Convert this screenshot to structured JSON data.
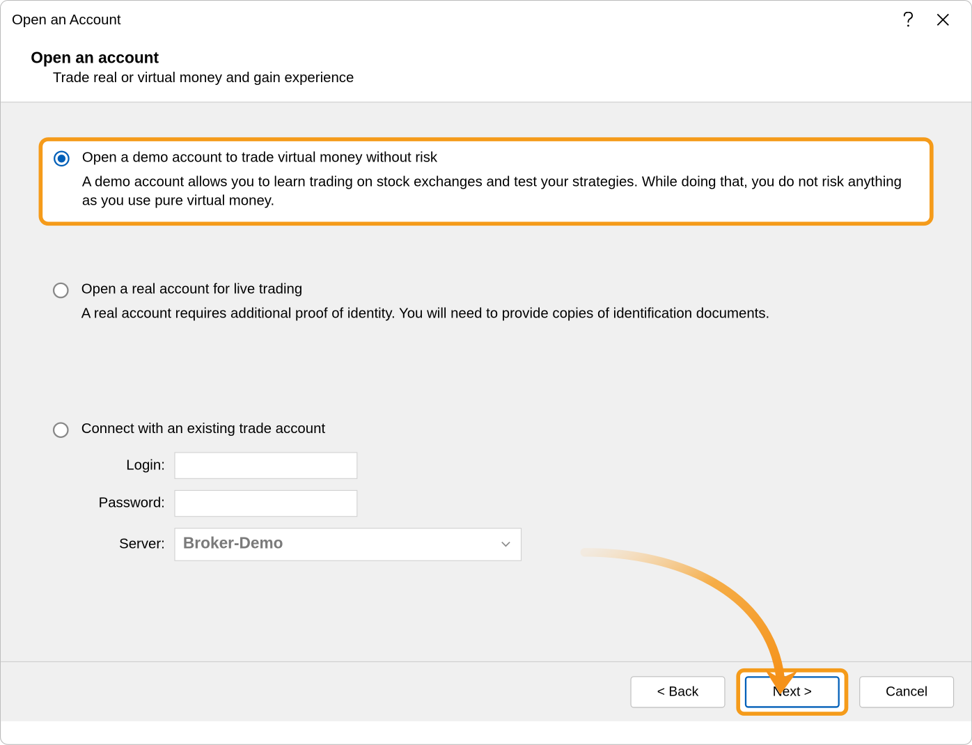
{
  "titlebar": {
    "title": "Open an Account"
  },
  "header": {
    "title": "Open an account",
    "subtitle": "Trade real or virtual money and gain experience"
  },
  "options": {
    "demo": {
      "title": "Open a demo account to trade virtual money without risk",
      "desc": "A demo account allows you to learn trading on stock exchanges and test your strategies. While doing that, you do not risk anything as you use pure virtual money."
    },
    "real": {
      "title": "Open a real account for live trading",
      "desc": "A real account requires additional proof of identity. You will need to provide copies of identification documents."
    },
    "existing": {
      "title": "Connect with an existing trade account",
      "login_label": "Login:",
      "password_label": "Password:",
      "server_label": "Server:",
      "server_value": "Broker-Demo"
    }
  },
  "footer": {
    "back": "< Back",
    "next": "Next >",
    "cancel": "Cancel"
  }
}
